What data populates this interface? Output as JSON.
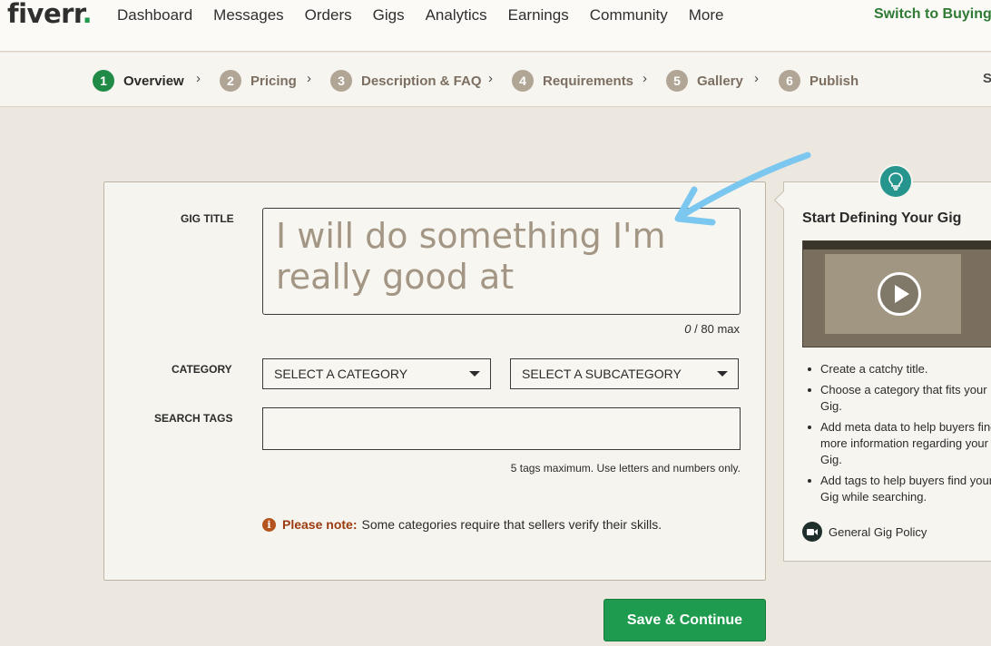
{
  "brand": {
    "logo": "fiverr",
    "logo_dot": ".",
    "accent": "#1f9b4f"
  },
  "nav": {
    "links": [
      "Dashboard",
      "Messages",
      "Orders",
      "Gigs",
      "Analytics",
      "Earnings",
      "Community",
      "More"
    ],
    "switch_label": "Switch to Buying"
  },
  "steps": [
    {
      "num": "1",
      "label": "Overview",
      "active": true
    },
    {
      "num": "2",
      "label": "Pricing",
      "active": false
    },
    {
      "num": "3",
      "label": "Description & FAQ",
      "active": false
    },
    {
      "num": "4",
      "label": "Requirements",
      "active": false
    },
    {
      "num": "5",
      "label": "Gallery",
      "active": false
    },
    {
      "num": "6",
      "label": "Publish",
      "active": false
    }
  ],
  "steps_edge_text": "Sa",
  "form": {
    "gig_title_label": "GIG TITLE",
    "gig_title_placeholder": "I will do something I'm really good at",
    "title_count": "0",
    "title_max": " / 80 max",
    "category_label": "CATEGORY",
    "category_select": "SELECT A CATEGORY",
    "subcategory_select": "SELECT A SUBCATEGORY",
    "search_tags_label": "SEARCH TAGS",
    "search_tags_value": "",
    "tags_hint": "5 tags maximum. Use letters and numbers only.",
    "note_strong": "Please note:",
    "note_text": "Some categories require that sellers verify their skills.",
    "save_label": "Save & Continue"
  },
  "tip": {
    "title": "Start Defining Your Gig",
    "items": [
      "Create a catchy title.",
      "Choose a category that fits your Gig.",
      "Add meta data to help buyers find more information regarding your Gig.",
      "Add tags to help buyers find your Gig while searching."
    ],
    "policy_link": "General Gig Policy"
  },
  "colors": {
    "arrow": "#7cc7ef",
    "step_active": "#1f8b46",
    "step_inactive": "#b1a596",
    "note_icon": "#b5531f"
  }
}
